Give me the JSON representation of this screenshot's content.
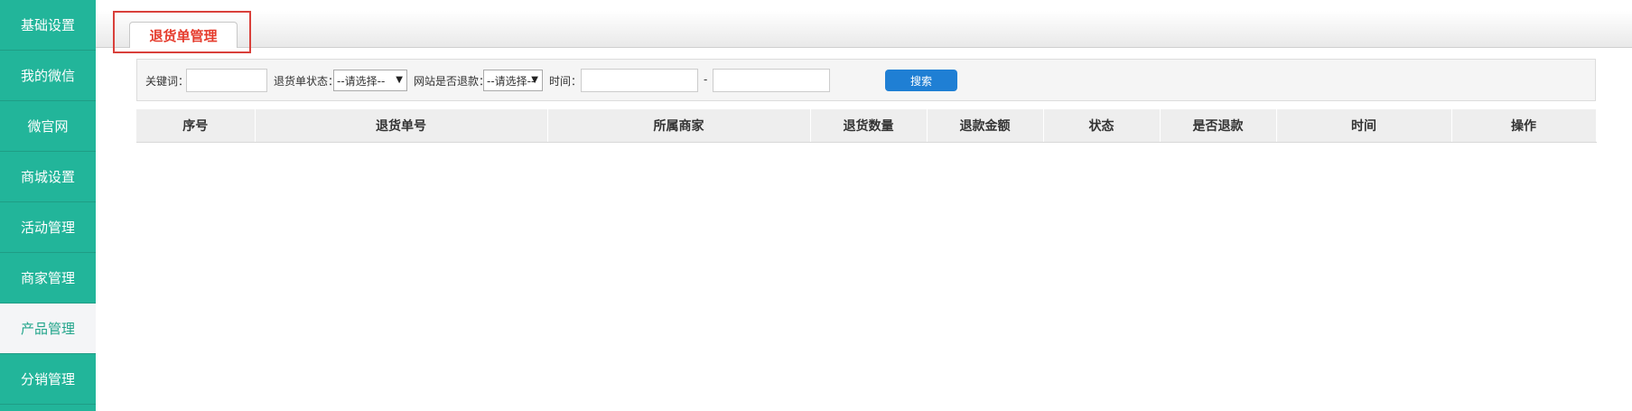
{
  "sidebar": {
    "items": [
      {
        "label": "基础设置"
      },
      {
        "label": "我的微信"
      },
      {
        "label": "微官网"
      },
      {
        "label": "商城设置"
      },
      {
        "label": "活动管理"
      },
      {
        "label": "商家管理"
      },
      {
        "label": "产品管理"
      },
      {
        "label": "分销管理"
      }
    ],
    "active_index": 6
  },
  "tabs": {
    "active_label": "退货单管理"
  },
  "filters": {
    "keyword": {
      "label": "关键词：",
      "value": ""
    },
    "status": {
      "label": "退货单状态：",
      "selected": "--请选择--"
    },
    "refund": {
      "label": "网站是否退款：",
      "selected": "--请选择--"
    },
    "time": {
      "label": "时间：",
      "start": "",
      "separator": "-",
      "end": ""
    },
    "search_label": "搜索"
  },
  "table": {
    "columns": [
      "序号",
      "退货单号",
      "所属商家",
      "退货数量",
      "退款金额",
      "状态",
      "是否退款",
      "时间",
      "操作"
    ],
    "rows": []
  },
  "colors": {
    "sidebar_bg": "#22b59a",
    "sidebar_active_bg": "#f4f5f7",
    "tab_text": "#e53b2c",
    "highlight_border": "#d9403b",
    "search_button": "#1f7fd4"
  }
}
